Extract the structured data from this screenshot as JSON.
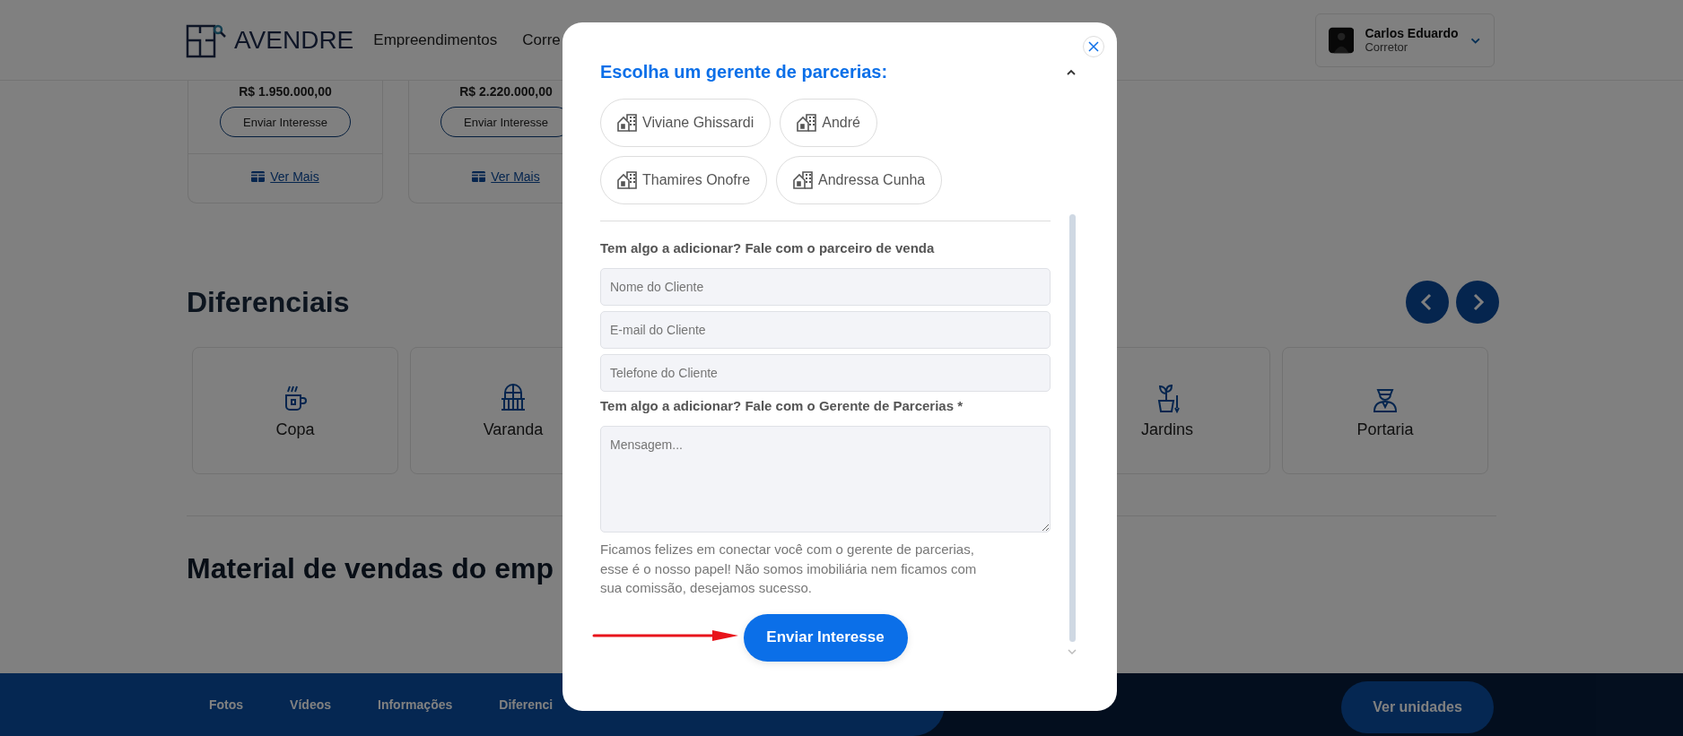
{
  "header": {
    "logo": "AVENDRE",
    "nav": [
      "Empreendimentos",
      "Corre"
    ],
    "user": {
      "name": "Carlos Eduardo",
      "role": "Corretor"
    }
  },
  "listings": [
    {
      "price": "R$ 1.950.000,00",
      "button": "Enviar Interesse",
      "link": "Ver Mais"
    },
    {
      "price": "R$ 2.220.000,00",
      "button": "Enviar Interesse",
      "link": "Ver Mais"
    }
  ],
  "features": {
    "title": "Diferenciais",
    "items": [
      {
        "label": "Copa",
        "kind": "cup"
      },
      {
        "label": "Varanda",
        "kind": "balcony"
      },
      {
        "label": "Jardins",
        "kind": "plant"
      },
      {
        "label": "Portaria",
        "kind": "doorman"
      }
    ]
  },
  "materials": {
    "title": "Material de vendas do emp"
  },
  "bottom_bar": {
    "items": [
      "Fotos",
      "Vídeos",
      "Informações",
      "Diferenci"
    ],
    "button": "Ver unidades"
  },
  "modal": {
    "title": "Escolha um gerente de parcerias:",
    "managers": [
      {
        "name": "Viviane Ghissardi",
        "selected": false
      },
      {
        "name": "André",
        "selected": false
      },
      {
        "name": "Thamires Onofre",
        "selected": false
      },
      {
        "name": "Andressa Cunha",
        "selected": false
      }
    ],
    "label_1": "Tem algo a adicionar? Fale com o parceiro de venda",
    "fields": [
      {
        "placeholder": "Nome do Cliente"
      },
      {
        "placeholder": "E-mail do Cliente"
      },
      {
        "placeholder": "Telefone do Cliente"
      }
    ],
    "label_2": "Tem algo a adicionar? Fale com o Gerente de Parcerias *",
    "message": {
      "placeholder": "Mensagem..."
    },
    "note": "Ficamos felizes em conectar você com o gerente de parcerias, esse é o nosso papel! Não somos imobiliária nem ficamos com sua comissão, desejamos sucesso.",
    "submit": "Enviar Interesse"
  }
}
